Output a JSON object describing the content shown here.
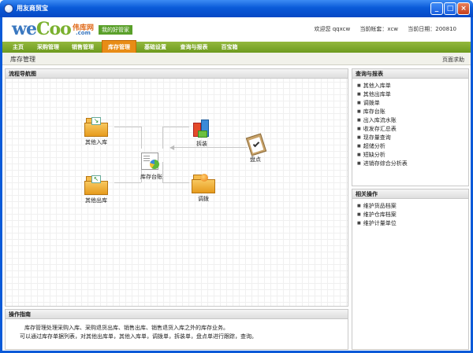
{
  "window": {
    "title": "用友商贸宝"
  },
  "header": {
    "logo_we": "we",
    "logo_coo": "Coo",
    "logo_cn": "伟库网",
    "logo_com": ".com",
    "slogan": "我的好管家",
    "user": "欢迎您 qqxcw",
    "account": "当前帐套：xcw",
    "date": "当前日期：200810"
  },
  "nav": {
    "tabs": [
      "主页",
      "采购管理",
      "销售管理",
      "库存管理",
      "基础设置",
      "查询与报表",
      "百宝箱"
    ],
    "active": "库存管理"
  },
  "subbar": {
    "crumb": "库存管理",
    "help": "页面求助"
  },
  "flow": {
    "title": "流程导航图",
    "nodes": {
      "other_in": "其他入库",
      "split": "拆装",
      "ledger": "库存台账",
      "check": "盘点",
      "other_out": "其他出库",
      "transfer": "调拨"
    }
  },
  "guide": {
    "title": "操作指南",
    "line1": "库存管理处理采购入库、采购退货出库、销售出库、销售退货入库之外的库存业务。",
    "line2": "可以通过库存单据列表，对其他出库单，其他入库单，调拨单，拆装单，盘点单进行跟踪，查询。"
  },
  "query": {
    "title": "查询与报表",
    "items": [
      "其他入库单",
      "其他出库单",
      "调拨单",
      "库存台账",
      "出入库流水账",
      "收发存汇总表",
      "现存量查询",
      "超储分析",
      "短缺分析",
      "进销存综合分析表"
    ]
  },
  "related": {
    "title": "相关操作",
    "items": [
      "维护货品档案",
      "维护仓库档案",
      "维护计量单位"
    ]
  }
}
